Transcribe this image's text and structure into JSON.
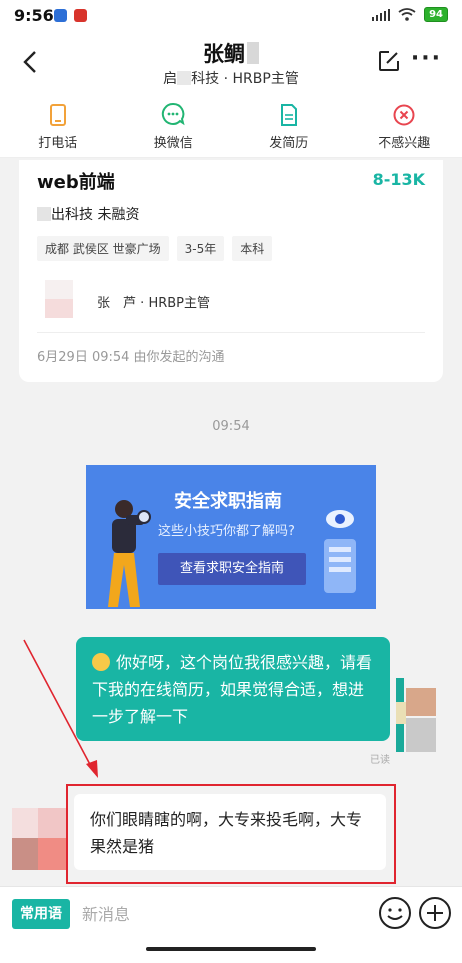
{
  "status": {
    "time": "9:56",
    "battery": "94"
  },
  "header": {
    "name": "张鲷",
    "company_prefix": "启",
    "company_suffix": "科技",
    "separator": "·",
    "role": "HRBP主管"
  },
  "actions": [
    {
      "label": "打电话",
      "icon": "phone-icon",
      "color": "#f2a23a"
    },
    {
      "label": "换微信",
      "icon": "wechat-icon",
      "color": "#22b573"
    },
    {
      "label": "发简历",
      "icon": "resume-icon",
      "color": "#19b5a4"
    },
    {
      "label": "不感兴趣",
      "icon": "not-interested-icon",
      "color": "#e8454f"
    }
  ],
  "job": {
    "title": "web前端",
    "salary": "8-13K",
    "company": "出科技",
    "funding": "未融资",
    "tags": [
      "成都 武侯区 世豪广场",
      "3-5年",
      "本科"
    ],
    "contact_name": "张　芦",
    "contact_separator": "·",
    "contact_role": "HRBP主管",
    "started": "6月29日 09:54 由你发起的沟通"
  },
  "chat": {
    "time": "09:54",
    "banner": {
      "title": "安全求职指南",
      "subtitle": "这些小技巧你都了解吗?",
      "button": "查看求职安全指南"
    },
    "outgoing": "你好呀，这个岗位我很感兴趣，请看下我的在线简历，如果觉得合适，想进一步了解一下",
    "read_status": "已读",
    "incoming": "你们眼睛瞎的啊，大专来投毛啊，大专果然是猪"
  },
  "input": {
    "phrase_button": "常用语",
    "placeholder": "新消息"
  },
  "colors": {
    "accent": "#19b5a4",
    "highlight_border": "#e0252f",
    "banner_bg": "#4a84e8"
  }
}
